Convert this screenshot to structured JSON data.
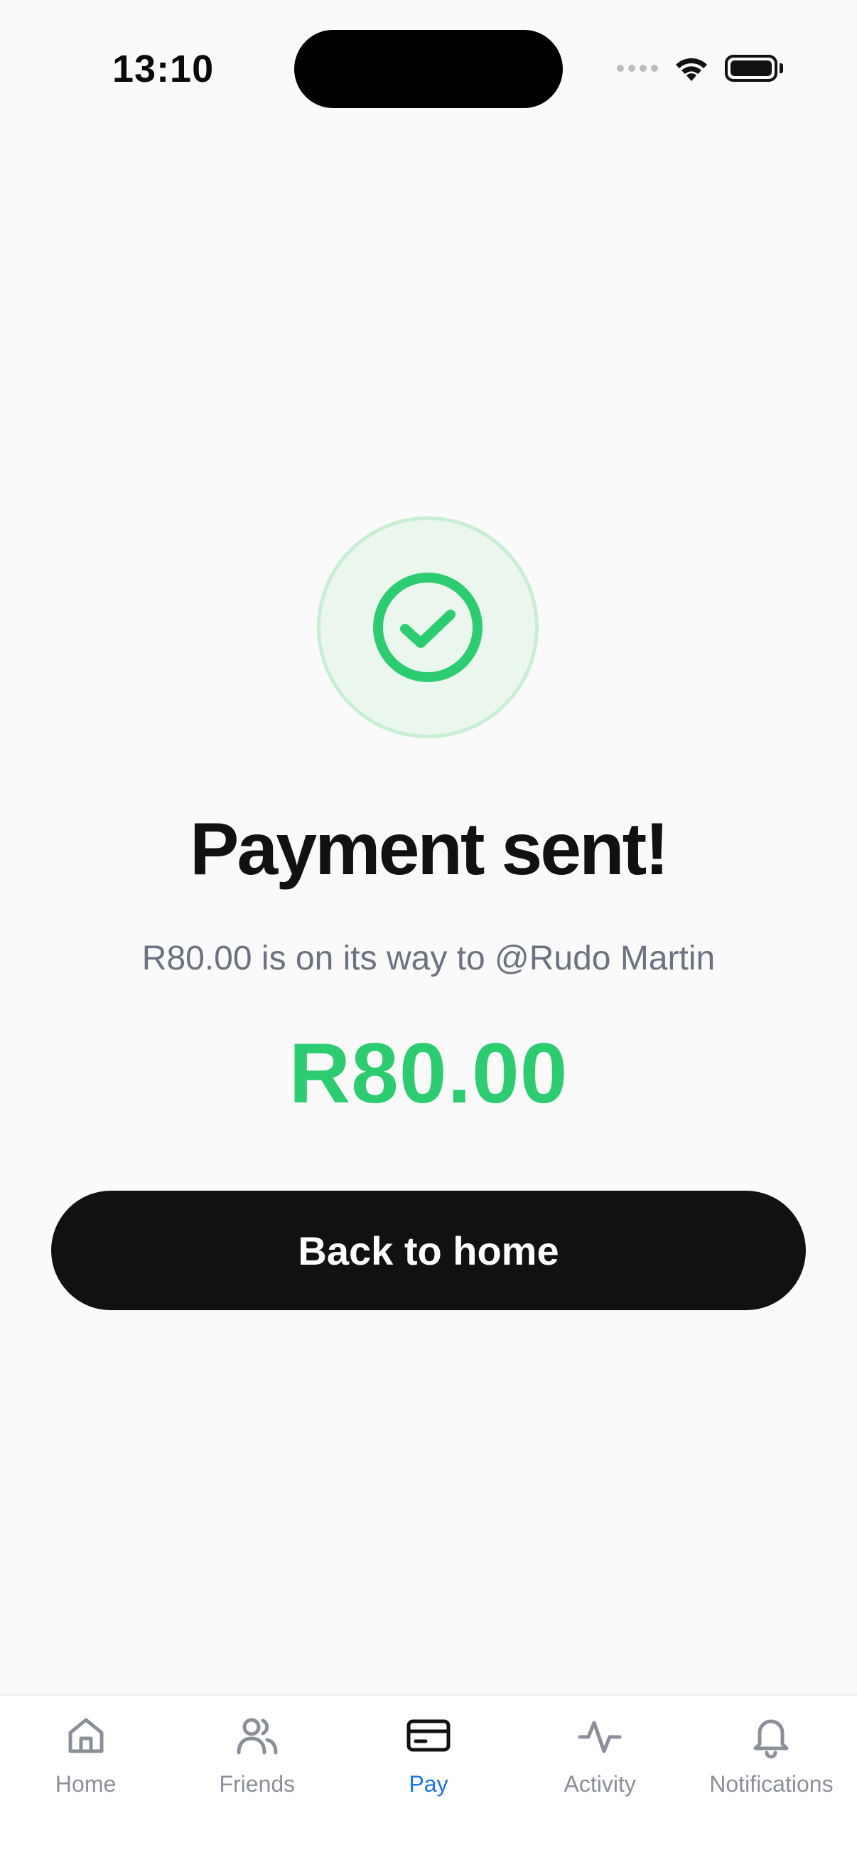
{
  "status_bar": {
    "time": "13:10"
  },
  "success": {
    "title": "Payment sent!",
    "subtitle": "R80.00 is on its way to @Rudo Martin",
    "amount": "R80.00",
    "icon": "check-circle-icon"
  },
  "actions": {
    "back_label": "Back to home"
  },
  "bottom_nav": {
    "items": [
      {
        "label": "Home",
        "icon": "home-icon",
        "active": false
      },
      {
        "label": "Friends",
        "icon": "friends-icon",
        "active": false
      },
      {
        "label": "Pay",
        "icon": "card-icon",
        "active": true
      },
      {
        "label": "Activity",
        "icon": "activity-icon",
        "active": false
      },
      {
        "label": "Notifications",
        "icon": "bell-icon",
        "active": false
      }
    ]
  },
  "colors": {
    "accent_green": "#2ecc71",
    "active_tab": "#1a73e8",
    "button_bg": "#111111",
    "muted_text": "#6b7280"
  }
}
